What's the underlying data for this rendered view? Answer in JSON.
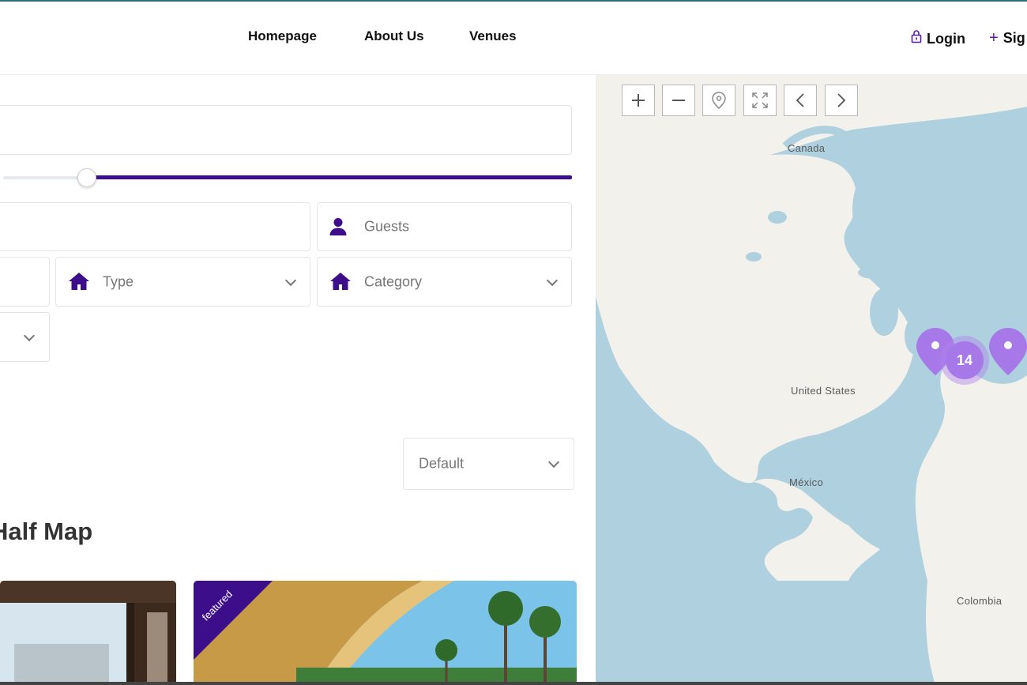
{
  "nav": {
    "items": [
      "Homepage",
      "About Us",
      "Venues"
    ]
  },
  "auth": {
    "login": "Login",
    "signup": "Sig"
  },
  "search": {
    "guests_placeholder": "Guests",
    "type_placeholder": "Type",
    "category_placeholder": "Category",
    "sort_value": "Default"
  },
  "price_slider": {
    "min_fraction": 0.15
  },
  "listing": {
    "title": "Half Map",
    "featured_badge": "featured"
  },
  "map": {
    "controls": [
      "zoom-in",
      "zoom-out",
      "locate",
      "fullscreen",
      "previous",
      "next"
    ],
    "labels": [
      "Canada",
      "United States",
      "México",
      "Colombia"
    ],
    "cluster_count": "14",
    "pin_color": "#a678e8"
  },
  "colors": {
    "accent": "#3d0e8a",
    "map_water": "#aed0df",
    "map_land": "#f2f1ec"
  }
}
